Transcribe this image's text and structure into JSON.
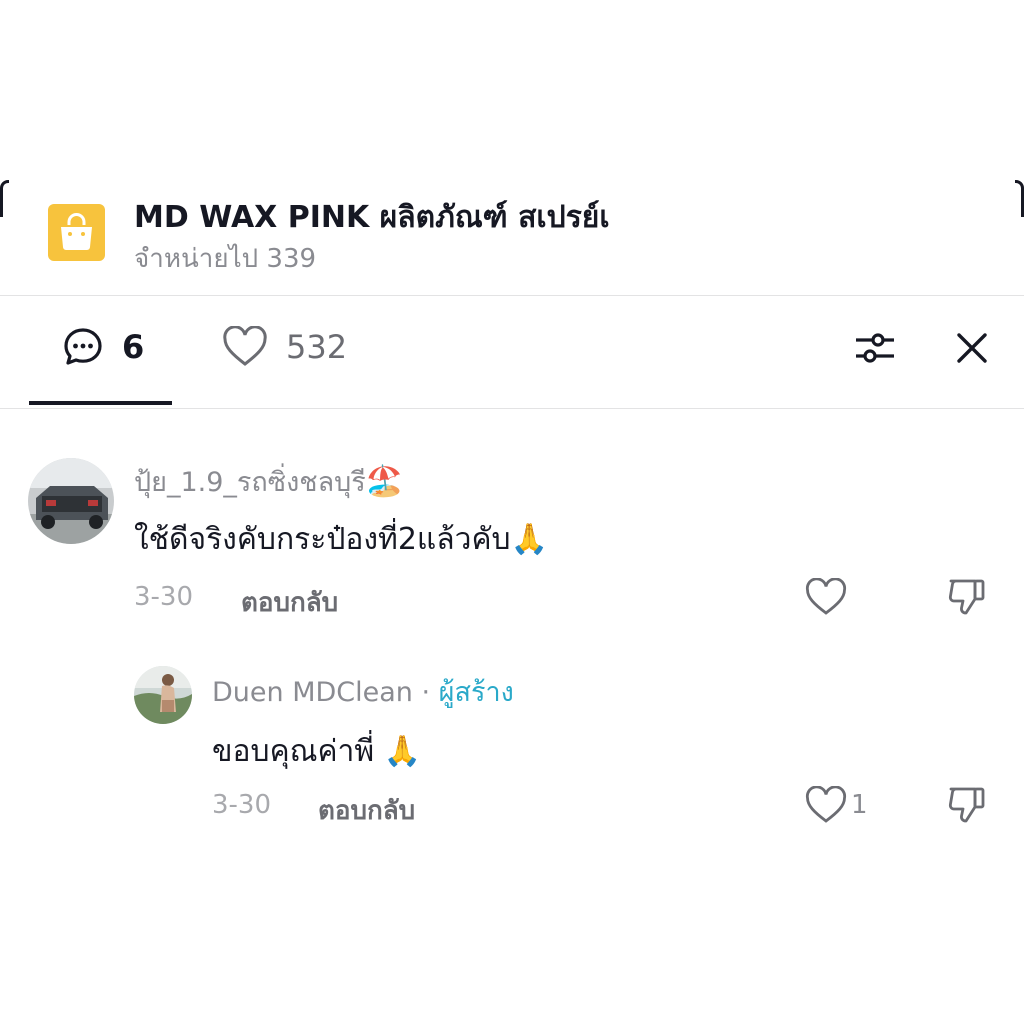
{
  "product": {
    "title": "MD  WAX PINK ผลิตภัณฑ์ สเปรย์เ",
    "sold": "จำหน่ายไป 339"
  },
  "tabs": {
    "comments_count": "6",
    "likes_count": "532"
  },
  "comments": [
    {
      "username": "ปุ้ย_1.9_รถซิ่งชลบุรี",
      "username_emoji": "🏖️",
      "text": "ใช้ดีจริงคับกระป๋องที่2แล้วคับ",
      "text_emoji": "🙏",
      "date": "3-30",
      "reply_label": "ตอบกลับ",
      "likes": ""
    },
    {
      "username": "Duen  MDClean",
      "separator": " · ",
      "creator_label": "ผู้สร้าง",
      "text": "ขอบคุณค่าพี่ ",
      "text_emoji": "🙏",
      "date": "3-30",
      "reply_label": "ตอบกลับ",
      "likes": "1"
    }
  ],
  "icons": {
    "bag": "shopping-bag-icon",
    "comment": "comment-bubble-icon",
    "heart": "heart-outline-icon",
    "filter": "sliders-filter-icon",
    "close": "close-icon",
    "dislike": "thumbs-down-icon"
  },
  "colors": {
    "bag_bg": "#F7C33D",
    "creator_tag": "#2aa9c9",
    "text": "#161823",
    "muted": "#8a8b91"
  }
}
